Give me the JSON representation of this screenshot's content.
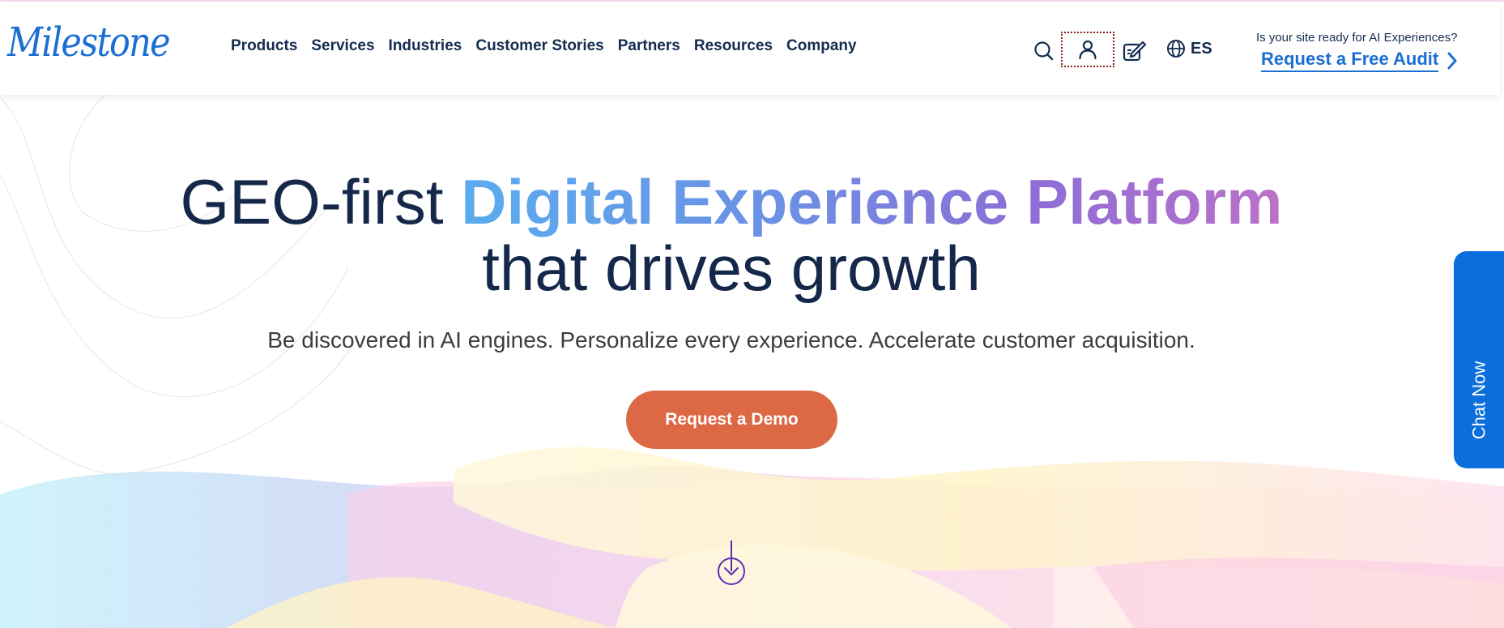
{
  "header": {
    "logo_text": "Milestone",
    "nav": [
      "Products",
      "Services",
      "Industries",
      "Customer Stories",
      "Partners",
      "Resources",
      "Company"
    ],
    "language": "ES",
    "audit_question": "Is your site ready for AI Experiences?",
    "audit_link": "Request a Free Audit",
    "icons": [
      "search-icon",
      "user-icon",
      "edit-icon",
      "globe-icon",
      "chevron-right-icon"
    ]
  },
  "hero": {
    "title_prefix": "GEO-first ",
    "title_highlight": "Digital Experience Platform",
    "title_line2": "that drives growth",
    "subtitle": "Be discovered in AI engines. Personalize every experience. Accelerate customer acquisition.",
    "cta": "Request a Demo"
  },
  "chat": {
    "label": "Chat Now"
  },
  "colors": {
    "brand_blue": "#1b6fd3",
    "navy_text": "#16284a",
    "cta_orange": "#dc6845",
    "chat_blue": "#0a6fdc",
    "gradient_start": "#5aacef",
    "gradient_end": "#bb72c8"
  }
}
